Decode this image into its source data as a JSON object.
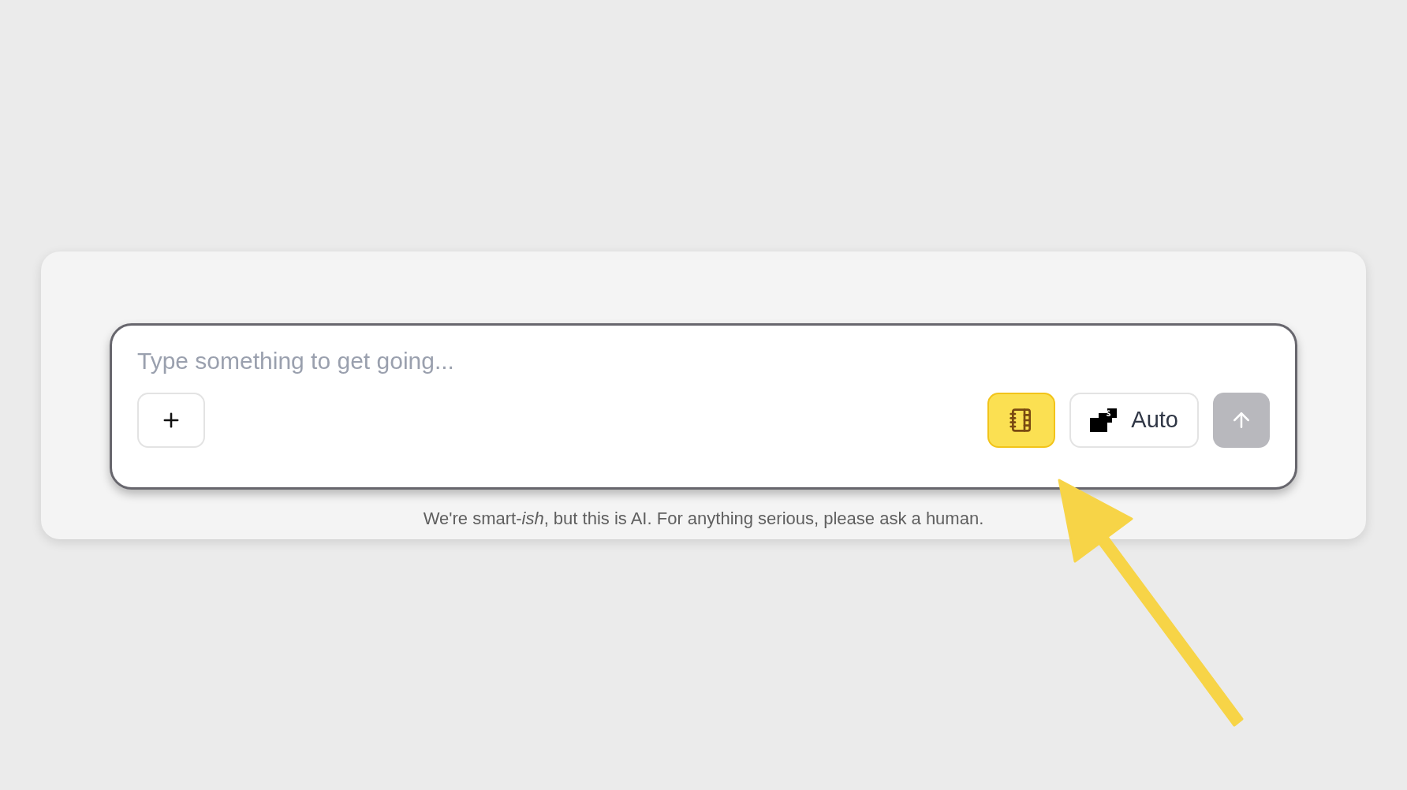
{
  "composer": {
    "placeholder": "Type something to get going...",
    "notebook_button": {
      "active": true
    },
    "model_button": {
      "label": "Auto"
    },
    "send_button": {
      "disabled": true
    }
  },
  "disclaimer": "We're smart-*ish*, but this is AI. For anything serious, please ask a human."
}
